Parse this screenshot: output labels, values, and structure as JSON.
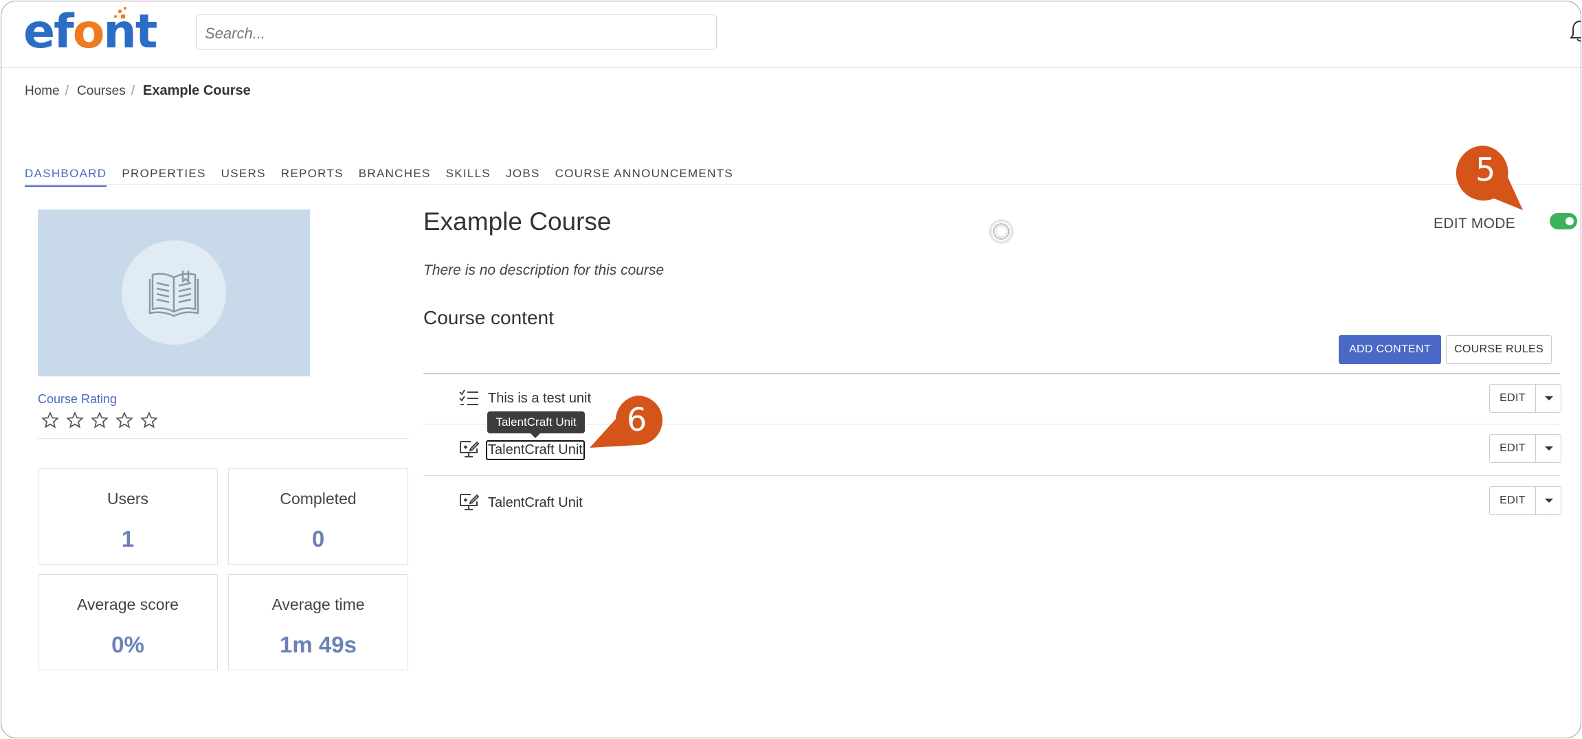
{
  "logo": {
    "text_ef": "ef",
    "text_o": "o",
    "text_rest": "nt",
    "alt": "efront"
  },
  "search": {
    "placeholder": "Search..."
  },
  "breadcrumb": {
    "items": [
      "Home",
      "Courses"
    ],
    "current": "Example Course"
  },
  "tabs": [
    "DASHBOARD",
    "PROPERTIES",
    "USERS",
    "REPORTS",
    "BRANCHES",
    "SKILLS",
    "JOBS",
    "COURSE ANNOUNCEMENTS"
  ],
  "active_tab": "DASHBOARD",
  "sidebar": {
    "rating_label": "Course Rating",
    "rating_value": 0,
    "rating_max": 5,
    "stats": [
      {
        "label": "Users",
        "value": "1"
      },
      {
        "label": "Completed",
        "value": "0"
      },
      {
        "label": "Average score",
        "value": "0%"
      },
      {
        "label": "Average time",
        "value": "1m 49s"
      }
    ]
  },
  "course": {
    "title": "Example Course",
    "description": "There is no description for this course",
    "edit_mode_label": "EDIT MODE",
    "edit_mode_on": true,
    "content_heading": "Course content",
    "add_content_label": "ADD CONTENT",
    "course_rules_label": "COURSE RULES",
    "units": [
      {
        "name": "This is a test unit",
        "icon": "checklist-icon",
        "edit_label": "EDIT"
      },
      {
        "name": "TalentCraft Unit",
        "icon": "monitor-edit-icon",
        "edit_label": "EDIT"
      },
      {
        "name": "TalentCraft Unit",
        "icon": "monitor-edit-icon",
        "edit_label": "EDIT"
      }
    ],
    "tooltip": "TalentCraft Unit"
  },
  "annotations": {
    "step_5": "5",
    "step_6": "6"
  },
  "colors": {
    "accent": "#4a68c5",
    "toggle_on": "#3db25b",
    "marker": "#d4541a",
    "stat_value": "#6b82b8"
  }
}
